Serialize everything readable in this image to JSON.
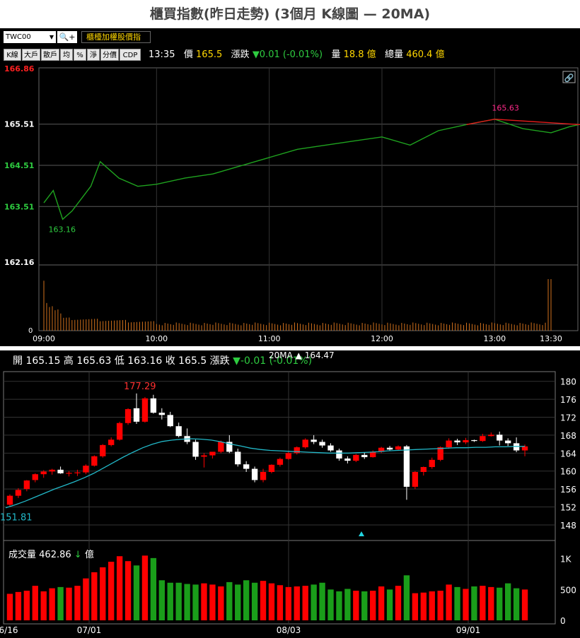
{
  "title": "櫃買指數(昨日走勢) (3個月 K線圖  — 20MA)",
  "intraday": {
    "symbol": "TWC00",
    "index_name": "櫃檯加權股價指",
    "buttons": [
      "K線",
      "大戶",
      "散戶",
      "均",
      "%",
      "淨",
      "分價",
      "CDP"
    ],
    "time": "13:35",
    "price_label": "價",
    "price": "165.5",
    "change_label": "漲跌",
    "change": "▼0.01 (-0.01%)",
    "volume_label": "量",
    "volume": "18.8 億",
    "total_label": "總量",
    "total": "460.4 億",
    "y_labels": [
      "166.86",
      "165.51",
      "164.51",
      "163.51",
      "162.16"
    ],
    "x_labels": [
      "09:00",
      "10:00",
      "11:00",
      "12:00",
      "13:00",
      "13:30"
    ],
    "high_label": "165.63",
    "low_label": "163.16",
    "vol_zero": "0",
    "colors": {
      "line": "#1fa31f",
      "line_high": "#e21b1b",
      "volume": "#d0701c",
      "high_text": "#ff2a8a",
      "low_text": "#2ecc40"
    }
  },
  "kline": {
    "open_label": "開",
    "open": "165.15",
    "high_label": "高",
    "high": "165.63",
    "low_label": "低",
    "low": "163.16",
    "close_label": "收",
    "close": "165.5",
    "change_label": "漲跌",
    "change": "▼-0.01 (-0.01%)",
    "ma_label": "20MA ▲ 164.47",
    "max_label": "177.29",
    "min_label": "151.81",
    "y_labels": [
      "180",
      "176",
      "172",
      "168",
      "164",
      "160",
      "156",
      "152",
      "148"
    ],
    "x_labels": [
      "6/16",
      "07/01",
      "08/03",
      "09/01"
    ],
    "vol_title": "成交量",
    "vol_value": "462.86",
    "vol_arrow": "↓",
    "vol_unit": "億",
    "vol_labels": [
      "1K",
      "500",
      "0"
    ],
    "colors": {
      "up": "#ff0000",
      "down": "#ffffff",
      "ma": "#22b8c8",
      "vol_up": "#ff0000",
      "vol_down": "#1a9e1a"
    }
  },
  "chart_data": [
    {
      "type": "line",
      "title": "櫃買指數(昨日走勢)",
      "xlabel": "",
      "ylabel": "",
      "ylim": [
        162.16,
        166.86
      ],
      "x_range": [
        "09:00",
        "13:30"
      ],
      "series": [
        {
          "x": [
            0,
            5,
            10,
            15,
            20,
            25,
            30,
            40,
            50,
            60,
            75,
            90,
            105,
            120,
            135,
            150,
            165,
            180,
            195,
            210,
            225,
            240,
            255,
            270,
            280,
            285,
            290,
            300,
            310,
            320,
            330
          ],
          "values": [
            163.6,
            163.9,
            163.2,
            163.4,
            163.7,
            164.0,
            164.6,
            164.2,
            164.0,
            164.05,
            164.2,
            164.3,
            164.5,
            164.7,
            164.9,
            165.0,
            165.1,
            165.2,
            165.0,
            165.35,
            165.5,
            165.63,
            165.4,
            165.3,
            165.45,
            165.5,
            165.52,
            165.5,
            165.5,
            165.5,
            165.5
          ]
        }
      ],
      "high": 165.63,
      "low": 163.16
    },
    {
      "type": "bar",
      "title": "",
      "ylabel": "",
      "volume_spike_open": 0.78,
      "volume_spike_close": 0.82
    },
    {
      "type": "candlestick",
      "title": "",
      "ylim": [
        145,
        182
      ],
      "x_labels": [
        "6/16",
        "07/01",
        "08/03",
        "09/01"
      ],
      "series": [
        {
          "name": "K",
          "ohlc": [
            [
              152.5,
              154.8,
              152.0,
              154.5
            ],
            [
              154.5,
              156.2,
              154.0,
              155.8
            ],
            [
              156.0,
              158.0,
              155.5,
              157.9
            ],
            [
              158.0,
              159.5,
              157.5,
              159.3
            ],
            [
              159.3,
              160.2,
              158.5,
              159.9
            ],
            [
              159.9,
              160.5,
              159.2,
              160.3
            ],
            [
              160.3,
              161.0,
              159.4,
              159.5
            ],
            [
              159.5,
              160.0,
              158.8,
              159.6
            ],
            [
              159.6,
              160.3,
              158.9,
              159.7
            ],
            [
              159.7,
              161.5,
              159.3,
              161.2
            ],
            [
              161.2,
              163.5,
              161.0,
              163.3
            ],
            [
              163.3,
              166.0,
              163.0,
              165.8
            ],
            [
              165.8,
              167.5,
              165.5,
              167.0
            ],
            [
              167.0,
              171.0,
              166.8,
              170.7
            ],
            [
              170.7,
              174.0,
              170.3,
              173.8
            ],
            [
              174.0,
              177.29,
              170.5,
              171.0
            ],
            [
              171.0,
              176.5,
              170.8,
              176.2
            ],
            [
              176.2,
              177.0,
              172.8,
              173.0
            ],
            [
              173.0,
              174.0,
              171.5,
              172.5
            ],
            [
              172.5,
              173.2,
              169.8,
              170.0
            ],
            [
              170.0,
              170.8,
              167.5,
              167.8
            ],
            [
              167.8,
              169.5,
              166.0,
              166.5
            ],
            [
              166.5,
              167.0,
              162.5,
              163.2
            ],
            [
              163.2,
              164.0,
              160.8,
              163.5
            ],
            [
              163.5,
              164.2,
              162.8,
              164.3
            ],
            [
              164.3,
              166.8,
              164.0,
              166.5
            ],
            [
              166.5,
              168.0,
              164.0,
              164.3
            ],
            [
              164.3,
              165.0,
              161.0,
              161.5
            ],
            [
              161.5,
              162.2,
              159.8,
              160.5
            ],
            [
              160.5,
              161.0,
              157.5,
              158.0
            ],
            [
              158.0,
              160.5,
              157.5,
              159.8
            ],
            [
              159.8,
              161.5,
              159.5,
              161.4
            ],
            [
              161.4,
              163.0,
              161.0,
              162.7
            ],
            [
              162.7,
              164.3,
              162.5,
              164.0
            ],
            [
              164.0,
              165.5,
              163.7,
              165.3
            ],
            [
              165.3,
              167.3,
              165.0,
              167.0
            ],
            [
              167.0,
              168.0,
              166.0,
              166.5
            ],
            [
              166.5,
              167.0,
              165.2,
              165.7
            ],
            [
              165.7,
              166.2,
              164.3,
              164.6
            ],
            [
              164.6,
              165.0,
              162.3,
              162.8
            ],
            [
              162.8,
              163.3,
              161.7,
              162.3
            ],
            [
              162.3,
              163.8,
              162.0,
              163.6
            ],
            [
              163.6,
              164.2,
              162.7,
              163.1
            ],
            [
              163.1,
              164.6,
              163.0,
              164.3
            ],
            [
              164.3,
              165.4,
              164.0,
              165.2
            ],
            [
              165.2,
              165.6,
              164.5,
              164.8
            ],
            [
              164.8,
              165.7,
              164.5,
              165.5
            ],
            [
              165.5,
              165.8,
              153.6,
              156.5
            ],
            [
              156.5,
              160.0,
              156.0,
              159.8
            ],
            [
              159.8,
              161.0,
              159.0,
              160.9
            ],
            [
              160.9,
              163.0,
              160.5,
              162.5
            ],
            [
              162.5,
              165.5,
              162.2,
              165.3
            ],
            [
              165.3,
              167.3,
              165.0,
              166.8
            ],
            [
              166.8,
              167.2,
              165.8,
              166.4
            ],
            [
              166.4,
              167.4,
              166.0,
              166.9
            ],
            [
              166.9,
              167.0,
              166.5,
              166.7
            ],
            [
              166.7,
              168.3,
              166.5,
              167.8
            ],
            [
              167.8,
              168.6,
              167.7,
              168.1
            ],
            [
              168.1,
              168.8,
              165.7,
              166.8
            ],
            [
              166.8,
              167.3,
              165.6,
              166.2
            ],
            [
              166.2,
              167.5,
              164.2,
              164.6
            ],
            [
              164.6,
              165.9,
              163.3,
              165.5
            ]
          ]
        },
        {
          "name": "20MA",
          "values": [
            151.8,
            152.5,
            153.3,
            154.2,
            155.1,
            156.0,
            156.8,
            157.6,
            158.5,
            159.5,
            160.7,
            161.9,
            163.1,
            164.2,
            165.2,
            166.0,
            166.6,
            166.9,
            167.1,
            167.2,
            167.1,
            166.9,
            166.5,
            166.0,
            165.6,
            165.1,
            164.8,
            164.6,
            164.5,
            164.4,
            164.3,
            164.2,
            164.1,
            164.0,
            164.0,
            164.0,
            164.1,
            164.2,
            164.3,
            164.5,
            164.6,
            164.7,
            164.8,
            164.9,
            165.0,
            165.1,
            165.2,
            165.2,
            165.3,
            165.3,
            165.4,
            165.4,
            165.5,
            165.5
          ]
        }
      ],
      "ma_value": 164.47
    },
    {
      "type": "bar",
      "title": "",
      "ylim": [
        0,
        1100
      ],
      "series": [
        {
          "name": "成交量",
          "values": [
            430,
            460,
            480,
            560,
            470,
            520,
            540,
            530,
            560,
            680,
            780,
            860,
            950,
            1040,
            960,
            890,
            1050,
            1010,
            650,
            610,
            610,
            590,
            580,
            600,
            580,
            550,
            620,
            580,
            650,
            610,
            640,
            600,
            570,
            540,
            550,
            560,
            580,
            610,
            500,
            470,
            510,
            480,
            470,
            480,
            550,
            500,
            560,
            730,
            440,
            450,
            470,
            480,
            580,
            540,
            510,
            550,
            560,
            540,
            530,
            600,
            520,
            500,
            410
          ]
        }
      ],
      "colors_up": [
        1,
        1,
        1,
        1,
        0,
        1,
        1,
        1,
        0,
        1,
        1,
        1,
        1,
        0,
        1,
        0,
        1,
        0,
        1,
        0,
        0,
        0,
        0,
        1,
        1,
        1,
        0,
        0,
        0,
        0,
        1,
        1,
        1,
        1,
        1,
        0,
        0,
        0,
        0,
        0,
        1,
        0,
        1,
        1,
        0,
        1,
        1,
        0,
        1,
        1,
        1,
        1,
        1,
        0,
        1,
        0,
        1,
        0,
        0,
        0,
        0,
        0
      ],
      "vol_value": 462.86
    }
  ]
}
